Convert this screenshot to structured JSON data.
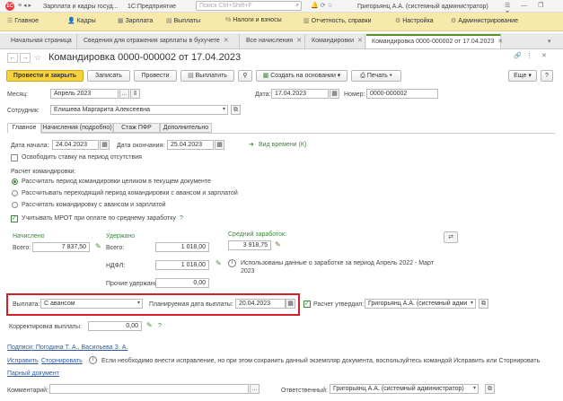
{
  "titlebar": {
    "app_title": "Зарплата и кадры госуд...",
    "app_mode": "1С:Предприятие",
    "search_placeholder": "Поиск Ctrl+Shift+F",
    "user": "Григорьянц А.А. (системный администратор)"
  },
  "menu": [
    "Главное",
    "Кадры",
    "Зарплата",
    "Выплаты",
    "Налоги и взносы",
    "Отчетность, справки",
    "Настройка",
    "Администрирование"
  ],
  "tabs": [
    "Начальная страница",
    "Сведения для отражения зарплаты в бухучете",
    "Все начисления",
    "Командировки",
    "Командировка 0000-000002 от 17.04.2023"
  ],
  "doc": {
    "title": "Командировка 0000-000002 от 17.04.2023",
    "btn_post_close": "Провести и закрыть",
    "btn_save": "Записать",
    "btn_post": "Провести",
    "btn_pay": "Выплатить",
    "btn_create_based": "Создать на основании",
    "btn_print": "Печать",
    "btn_more": "Еще",
    "help": "?"
  },
  "fields": {
    "month_label": "Месяц:",
    "month_value": "Апрель 2023",
    "date_label": "Дата:",
    "date_value": "17.04.2023",
    "number_label": "Номер:",
    "number_value": "0000-000002",
    "employee_label": "Сотрудник:",
    "employee_value": "Елишева Маргарита Алексеевна"
  },
  "subtabs": [
    "Главное",
    "Начисления (подробно)",
    "Стаж ПФР",
    "Дополнительно"
  ],
  "main": {
    "start_label": "Дата начала:",
    "start_value": "24.04.2023",
    "end_label": "Дата окончания:",
    "end_value": "25.04.2023",
    "time_type": "Вид времени (К)",
    "release_rate": "Освободить ставку на период отсутствия",
    "calc_label": "Расчет командировки:",
    "radio1": "Рассчитать период командировки целиком в текущем документе",
    "radio2": "Рассчитывать переходящий период командировки с авансом и зарплатой",
    "radio3": "Рассчитать командировку с авансом и зарплатой",
    "mrot": "Учитывать МРОТ при оплате по среднему заработку",
    "accrued_header": "Начислено",
    "total_label": "Всего:",
    "accrued_total": "7 837,50",
    "withheld_header": "Удержано",
    "withheld_total_label": "Всего:",
    "withheld_total": "1 018,00",
    "ndfl_label": "НДФЛ:",
    "ndfl_value": "1 018,00",
    "other_label": "Прочие удержания:",
    "other_value": "0,00",
    "avg_header": "Средний заработок:",
    "avg_value": "3 918,75",
    "info_text_1": "Использованы данные о заработке за период Апрель 2022 - Март",
    "info_text_2": "2023",
    "payout_label": "Выплата:",
    "payout_value": "С авансом",
    "planned_date_label": "Планируемая дата выплаты:",
    "planned_date_value": "20.04.2023",
    "approved_label": "Расчет утвердил:",
    "approved_value": "Григорьянц А.А. (системный адми",
    "correction_label": "Корректировка выплаты:",
    "correction_value": "0,00"
  },
  "footer": {
    "signature": "Подписи: Погодина Т. А., Васильева З. А.",
    "fix": "Исправить",
    "reverse": "Сторнировать",
    "fix_note": "Если необходимо внести исправление, но при этом сохранить данный экземпляр документа, воспользуйтесь командой Исправить или Сторнировать",
    "paired": "Парный документ",
    "comment_label": "Комментарий:",
    "responsible_label": "Ответственный:",
    "responsible_value": "Григорьянц А.А. (системный администратор)"
  },
  "colors": {
    "accent_yellow": "#f5d33f",
    "menu_bg": "#f6e9a9",
    "active_green": "#5a8f2e",
    "highlight_red": "#d0202a"
  }
}
